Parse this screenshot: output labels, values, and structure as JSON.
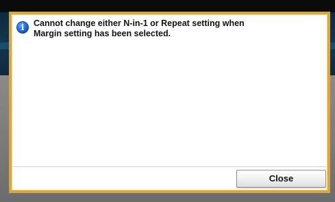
{
  "dialog": {
    "icon": "info-icon",
    "icon_glyph": "i",
    "message_line1": "Cannot change either N-in-1 or Repeat setting when",
    "message_line2": "Margin setting has been selected.",
    "close_label": "Close"
  },
  "colors": {
    "dialog_border": "#e4a52b",
    "info_icon": "#1259c3",
    "header_band": "#12364f"
  }
}
